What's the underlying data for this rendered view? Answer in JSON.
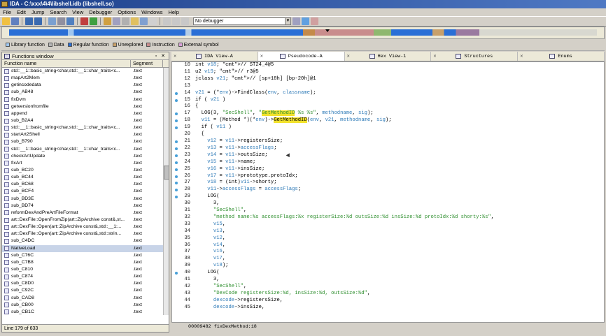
{
  "window": {
    "title": "IDA - C:\\xxx\\4\\4\\libshell.idb (libshell.so)"
  },
  "menu": [
    "File",
    "Edit",
    "Jump",
    "Search",
    "View",
    "Debugger",
    "Options",
    "Windows",
    "Help"
  ],
  "toolbar": {
    "debugger_select": "No debugger"
  },
  "legend": [
    {
      "label": "Library function",
      "color": "#9fc6ef"
    },
    {
      "label": "Data",
      "color": "#b4b4b4"
    },
    {
      "label": "Regular function",
      "color": "#2a6fd6"
    },
    {
      "label": "Unexplored",
      "color": "#c8a06a"
    },
    {
      "label": "Instruction",
      "color": "#c98d8d"
    },
    {
      "label": "External symbol",
      "color": "#d8a0d8"
    }
  ],
  "functions": {
    "title": "Functions window",
    "col_name": "Function name",
    "col_segment": "Segment",
    "status": "Line 179 of 633",
    "rows": [
      {
        "name": "std::__1::basic_string<char,std::__1::char_traits<c...",
        "seg": ".text"
      },
      {
        "name": "mapArt2Mem",
        "seg": ".text"
      },
      {
        "name": "getincodedata",
        "seg": ".text"
      },
      {
        "name": "sub_AB48",
        "seg": ".text"
      },
      {
        "name": "fixDvm",
        "seg": ".text"
      },
      {
        "name": "getversionfromfile",
        "seg": ".text"
      },
      {
        "name": "append",
        "seg": ".text"
      },
      {
        "name": "sub_B2A4",
        "seg": ".text"
      },
      {
        "name": "std::__1::basic_string<char,std::__1::char_traits<c...",
        "seg": ".text"
      },
      {
        "name": "startArt2Shell",
        "seg": ".text"
      },
      {
        "name": "sub_B790",
        "seg": ".text"
      },
      {
        "name": "std::__1::basic_string<char,std::__1::char_traits<c...",
        "seg": ".text"
      },
      {
        "name": "checkArtUpdate",
        "seg": ".text"
      },
      {
        "name": "fixArt",
        "seg": ".text"
      },
      {
        "name": "sub_BC20",
        "seg": ".text"
      },
      {
        "name": "sub_BC44",
        "seg": ".text"
      },
      {
        "name": "sub_BC68",
        "seg": ".text"
      },
      {
        "name": "sub_BCF4",
        "seg": ".text"
      },
      {
        "name": "sub_BD3E",
        "seg": ".text"
      },
      {
        "name": "sub_BD74",
        "seg": ".text"
      },
      {
        "name": "reformDexAndPreArtFileFormat",
        "seg": ".text"
      },
      {
        "name": "art::DexFile::OpenFromZip(art::ZipArchive const&,st...",
        "seg": ".text"
      },
      {
        "name": "art::DexFile::Open(art::ZipArchive const&,std::__1:...",
        "seg": ".text"
      },
      {
        "name": "art::DexFile::Open(art::ZipArchive const&,std::strin...",
        "seg": ".text"
      },
      {
        "name": "sub_C4DC",
        "seg": ".text"
      },
      {
        "name": "NativeLoad",
        "seg": ".text"
      },
      {
        "name": "sub_C76C",
        "seg": ".text"
      },
      {
        "name": "sub_C7B8",
        "seg": ".text"
      },
      {
        "name": "sub_C810",
        "seg": ".text"
      },
      {
        "name": "sub_C874",
        "seg": ".text"
      },
      {
        "name": "sub_C8D0",
        "seg": ".text"
      },
      {
        "name": "sub_C92C",
        "seg": ".text"
      },
      {
        "name": "sub_CAD8",
        "seg": ".text"
      },
      {
        "name": "sub_CB00",
        "seg": ".text"
      },
      {
        "name": "sub_CB1C",
        "seg": ".text"
      }
    ],
    "selected_index": 25
  },
  "tabs": [
    {
      "label": "IDA View-A"
    },
    {
      "label": "Pseudocode-A",
      "active": true
    },
    {
      "label": "Hex View-1"
    },
    {
      "label": "Structures"
    },
    {
      "label": "Enums"
    }
  ],
  "code": {
    "status": "00009482 fixDexMethod:18",
    "lines": [
      {
        "n": "10",
        "t": "int v18; // ST24_4@5",
        "dot": false
      },
      {
        "n": "11",
        "t": "u2 v19; // r3@5",
        "dot": false
      },
      {
        "n": "12",
        "t": "jclass v21; // [sp+18h] [bp-20h]@1",
        "dot": false
      },
      {
        "n": "13",
        "t": "",
        "dot": false
      },
      {
        "n": "14",
        "t": "v21 = (*env)->FindClass(env, classname);",
        "dot": true
      },
      {
        "n": "15",
        "t": "if ( v21 )",
        "dot": true
      },
      {
        "n": "16",
        "t": "{",
        "dot": false
      },
      {
        "n": "17",
        "t": "  LOG(3, \"SecShell\", \"GetMethodID %s %s\", methodname, sig);",
        "dot": true
      },
      {
        "n": "18",
        "t": "  v11 = (Method *)(*env)->GetMethodID(env, v21, methodname, sig);",
        "dot": true
      },
      {
        "n": "19",
        "t": "  if ( v11 )",
        "dot": true
      },
      {
        "n": "20",
        "t": "  {",
        "dot": false
      },
      {
        "n": "21",
        "t": "    v12 = v11->registersSize;",
        "dot": true
      },
      {
        "n": "22",
        "t": "    v13 = v11->accessFlags;",
        "dot": true
      },
      {
        "n": "23",
        "t": "    v14 = v11->outsSize;",
        "dot": true
      },
      {
        "n": "24",
        "t": "    v15 = v11->name;",
        "dot": true
      },
      {
        "n": "25",
        "t": "    v16 = v11->insSize;",
        "dot": true
      },
      {
        "n": "26",
        "t": "    v17 = v11->prototype.protoIdx;",
        "dot": true
      },
      {
        "n": "27",
        "t": "    v18 = (int)v11->shorty;",
        "dot": true
      },
      {
        "n": "28",
        "t": "    v11->accessFlags = accessFlags;",
        "dot": true
      },
      {
        "n": "29",
        "t": "    LOG(",
        "dot": true
      },
      {
        "n": "30",
        "t": "      3,",
        "dot": false
      },
      {
        "n": "31",
        "t": "      \"SecShell\",",
        "dot": false
      },
      {
        "n": "32",
        "t": "      \"method name:%s accessFlags:%x registerSize:%d outsSize:%d insSize:%d protoIdx:%d shorty:%s\",",
        "dot": false
      },
      {
        "n": "33",
        "t": "      v15,",
        "dot": false
      },
      {
        "n": "34",
        "t": "      v13,",
        "dot": false
      },
      {
        "n": "35",
        "t": "      v12,",
        "dot": false
      },
      {
        "n": "36",
        "t": "      v14,",
        "dot": false
      },
      {
        "n": "37",
        "t": "      v16,",
        "dot": false
      },
      {
        "n": "38",
        "t": "      v17,",
        "dot": false
      },
      {
        "n": "39",
        "t": "      v18);",
        "dot": false
      },
      {
        "n": "40",
        "t": "    LOG(",
        "dot": true
      },
      {
        "n": "41",
        "t": "      3,",
        "dot": false
      },
      {
        "n": "42",
        "t": "      \"SecShell\",",
        "dot": false
      },
      {
        "n": "43",
        "t": "      \"DexCode registersSize:%d, insSize:%d, outsSize:%d\",",
        "dot": false
      },
      {
        "n": "44",
        "t": "      dexcode->registersSize,",
        "dot": false
      },
      {
        "n": "45",
        "t": "      dexcode->insSize,",
        "dot": false
      }
    ]
  }
}
